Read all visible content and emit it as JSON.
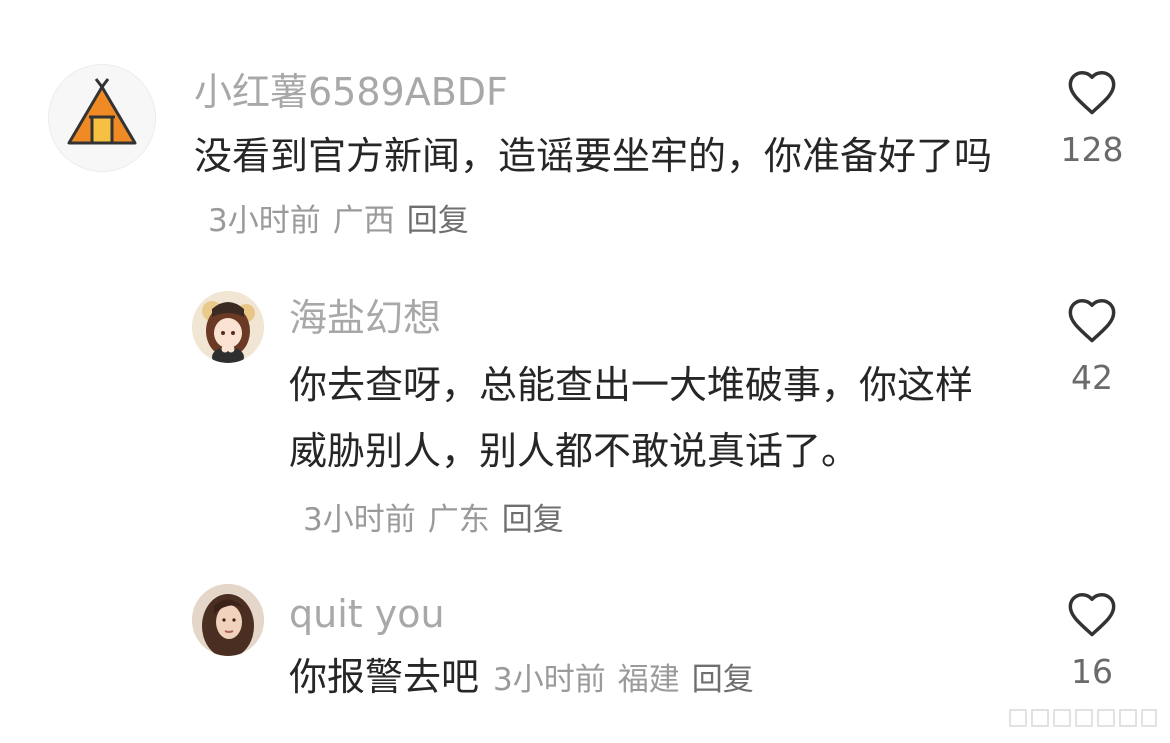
{
  "comments": [
    {
      "username": "小红薯6589ABDF",
      "text": "没看到官方新闻，造谣要坐牢的，你准备好了吗",
      "time": "3小时前",
      "location": "广西",
      "reply_label": "回复",
      "likes": "128",
      "avatar_icon": "tent-icon"
    },
    {
      "username": "海盐幻想",
      "text": "你去查呀，总能查出一大堆破事，你这样威胁别人，别人都不敢说真话了。",
      "time": "3小时前",
      "location": "广东",
      "reply_label": "回复",
      "likes": "42",
      "avatar_icon": "anime-girl-avatar"
    },
    {
      "username": "quit you",
      "text": "你报警去吧",
      "time": "3小时前",
      "location": "福建",
      "reply_label": "回复",
      "likes": "16",
      "avatar_icon": "woman-photo-avatar"
    }
  ],
  "colors": {
    "username": "#a8a8a8",
    "text": "#262626",
    "meta": "#9a9a9a",
    "tent": "#f08a24"
  },
  "watermark_icon": "watermark-icon"
}
